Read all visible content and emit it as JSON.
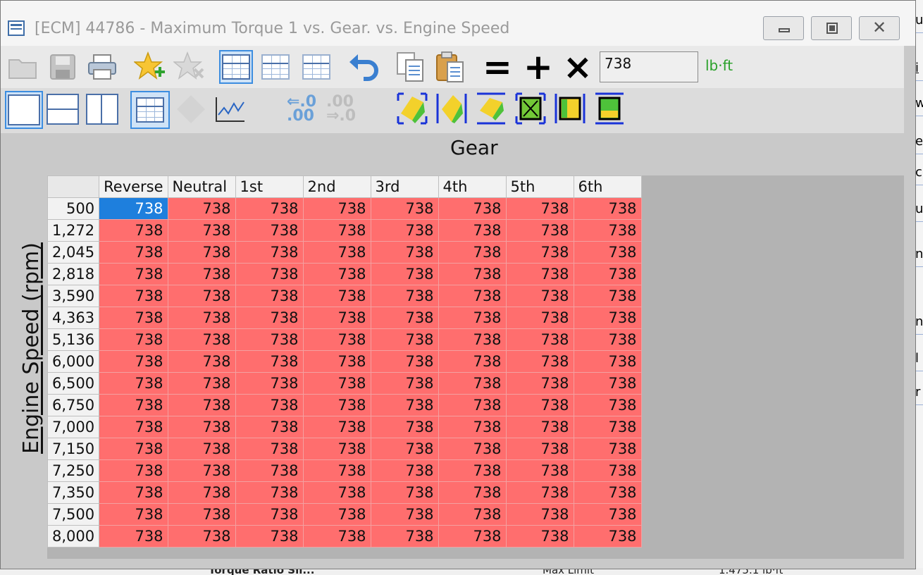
{
  "window": {
    "title": "[ECM] 44786 - Maximum Torque 1 vs. Gear. vs. Engine Speed",
    "buttons": {
      "minimize": "",
      "restore": "",
      "close": "✕"
    }
  },
  "toolbar": {
    "value_input": "738",
    "unit": "lb·ft",
    "ops": {
      "equals": "=",
      "plus": "+",
      "multiply": "×"
    },
    "shift_left_top": "⇐.0",
    "shift_left_bottom": ".00",
    "shift_right_top": ".00",
    "shift_right_bottom": "⇒.0"
  },
  "axes": {
    "x_label": "Gear",
    "y_label": "Engine Speed (rpm)"
  },
  "table": {
    "columns": [
      "Reverse",
      "Neutral",
      "1st",
      "2nd",
      "3rd",
      "4th",
      "5th",
      "6th"
    ],
    "rows": [
      {
        "rpm": "500",
        "values": [
          "738",
          "738",
          "738",
          "738",
          "738",
          "738",
          "738",
          "738"
        ]
      },
      {
        "rpm": "1,272",
        "values": [
          "738",
          "738",
          "738",
          "738",
          "738",
          "738",
          "738",
          "738"
        ]
      },
      {
        "rpm": "2,045",
        "values": [
          "738",
          "738",
          "738",
          "738",
          "738",
          "738",
          "738",
          "738"
        ]
      },
      {
        "rpm": "2,818",
        "values": [
          "738",
          "738",
          "738",
          "738",
          "738",
          "738",
          "738",
          "738"
        ]
      },
      {
        "rpm": "3,590",
        "values": [
          "738",
          "738",
          "738",
          "738",
          "738",
          "738",
          "738",
          "738"
        ]
      },
      {
        "rpm": "4,363",
        "values": [
          "738",
          "738",
          "738",
          "738",
          "738",
          "738",
          "738",
          "738"
        ]
      },
      {
        "rpm": "5,136",
        "values": [
          "738",
          "738",
          "738",
          "738",
          "738",
          "738",
          "738",
          "738"
        ]
      },
      {
        "rpm": "6,000",
        "values": [
          "738",
          "738",
          "738",
          "738",
          "738",
          "738",
          "738",
          "738"
        ]
      },
      {
        "rpm": "6,500",
        "values": [
          "738",
          "738",
          "738",
          "738",
          "738",
          "738",
          "738",
          "738"
        ]
      },
      {
        "rpm": "6,750",
        "values": [
          "738",
          "738",
          "738",
          "738",
          "738",
          "738",
          "738",
          "738"
        ]
      },
      {
        "rpm": "7,000",
        "values": [
          "738",
          "738",
          "738",
          "738",
          "738",
          "738",
          "738",
          "738"
        ]
      },
      {
        "rpm": "7,150",
        "values": [
          "738",
          "738",
          "738",
          "738",
          "738",
          "738",
          "738",
          "738"
        ]
      },
      {
        "rpm": "7,250",
        "values": [
          "738",
          "738",
          "738",
          "738",
          "738",
          "738",
          "738",
          "738"
        ]
      },
      {
        "rpm": "7,350",
        "values": [
          "738",
          "738",
          "738",
          "738",
          "738",
          "738",
          "738",
          "738"
        ]
      },
      {
        "rpm": "7,500",
        "values": [
          "738",
          "738",
          "738",
          "738",
          "738",
          "738",
          "738",
          "738"
        ]
      },
      {
        "rpm": "8,000",
        "values": [
          "738",
          "738",
          "738",
          "738",
          "738",
          "738",
          "738",
          "738"
        ]
      }
    ],
    "selected_cell": {
      "row": 0,
      "col": 0
    }
  },
  "background": {
    "right_glyphs": [
      "u",
      "i",
      "w",
      "e",
      "c",
      "u",
      "n",
      "",
      "n",
      "l",
      "r"
    ],
    "bottom_texts": [
      "Torque Ratio Sli...",
      "Max Limit",
      "1.475.1 lb·ft"
    ]
  },
  "colors": {
    "cell_high": "#ff6e6e",
    "selected": "#1e7fdd",
    "unit_text": "#2aa12a"
  }
}
